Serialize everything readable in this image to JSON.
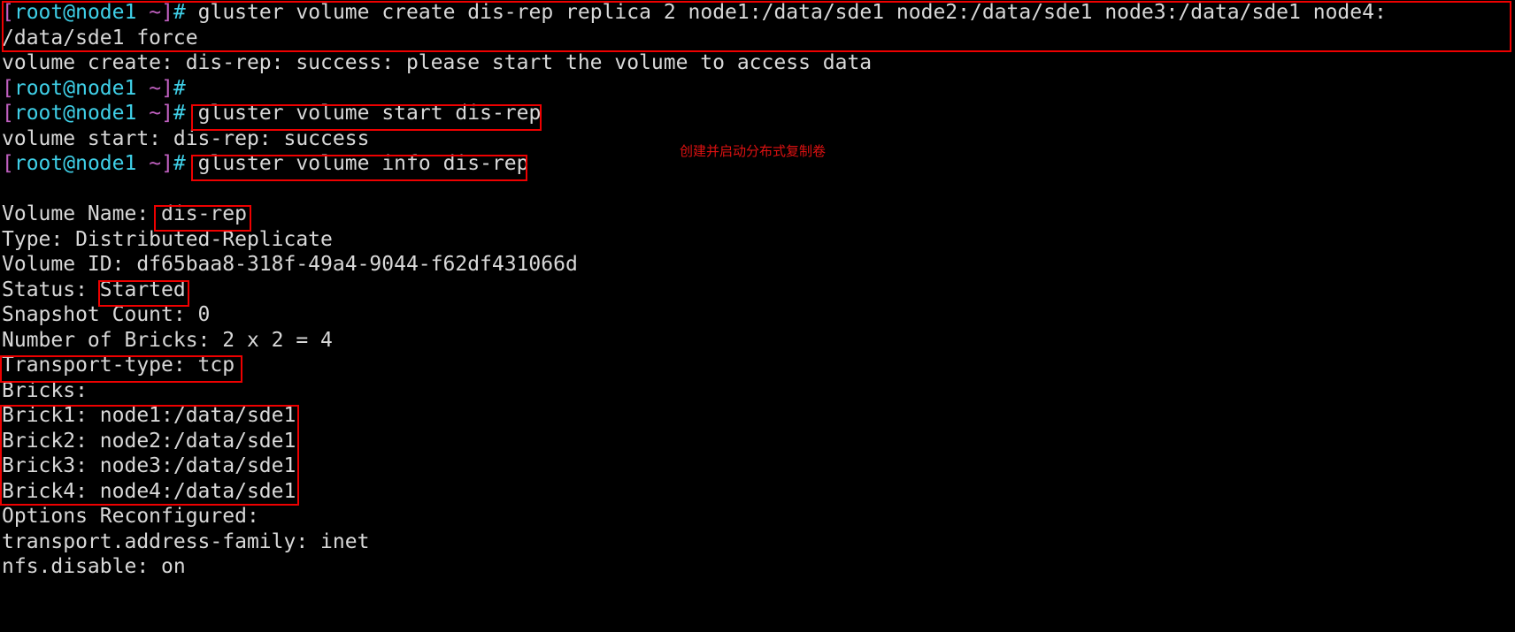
{
  "terminal": {
    "prompt": {
      "open_bracket": "[",
      "user_host": "root@node1",
      "tilde": "~",
      "close_bracket": "]",
      "hash": "#",
      "colors": {
        "bracket": "#c060c0",
        "user_host": "#3fd0e8",
        "hash": "#3fd0e8",
        "output": "#d8d8d8",
        "background": "#000000",
        "annotation": "#ee0000"
      }
    },
    "lines": [
      {
        "type": "command",
        "text": " gluster volume create dis-rep replica 2 node1:/data/sde1 node2:/data/sde1 node3:/data/sde1 node4:"
      },
      {
        "type": "wrap",
        "text": "/data/sde1 force"
      },
      {
        "type": "output",
        "text": "volume create: dis-rep: success: please start the volume to access data"
      },
      {
        "type": "prompt-only",
        "text": ""
      },
      {
        "type": "command",
        "text": " gluster volume start dis-rep"
      },
      {
        "type": "output",
        "text": "volume start: dis-rep: success"
      },
      {
        "type": "command",
        "text": " gluster volume info dis-rep"
      },
      {
        "type": "blank",
        "text": ""
      },
      {
        "type": "output",
        "text": "Volume Name: dis-rep"
      },
      {
        "type": "output",
        "text": "Type: Distributed-Replicate"
      },
      {
        "type": "output",
        "text": "Volume ID: df65baa8-318f-49a4-9044-f62df431066d"
      },
      {
        "type": "output",
        "text": "Status: Started"
      },
      {
        "type": "output",
        "text": "Snapshot Count: 0"
      },
      {
        "type": "output",
        "text": "Number of Bricks: 2 x 2 = 4"
      },
      {
        "type": "output",
        "text": "Transport-type: tcp"
      },
      {
        "type": "output",
        "text": "Bricks:"
      },
      {
        "type": "output",
        "text": "Brick1: node1:/data/sde1"
      },
      {
        "type": "output",
        "text": "Brick2: node2:/data/sde1"
      },
      {
        "type": "output",
        "text": "Brick3: node3:/data/sde1"
      },
      {
        "type": "output",
        "text": "Brick4: node4:/data/sde1"
      },
      {
        "type": "output",
        "text": "Options Reconfigured:"
      },
      {
        "type": "output",
        "text": "transport.address-family: inet"
      },
      {
        "type": "output",
        "text": "nfs.disable: on"
      }
    ],
    "annotation": {
      "text": "创建并启动分布式复制卷"
    }
  }
}
